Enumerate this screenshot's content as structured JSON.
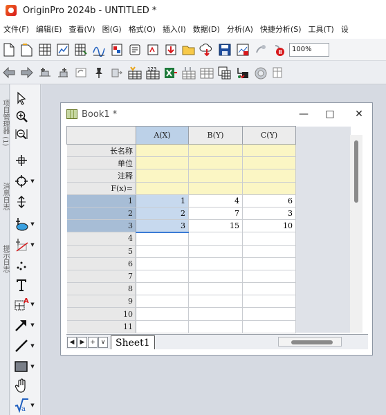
{
  "app": {
    "title": "OriginPro 2024b - UNTITLED *"
  },
  "menu": [
    "文件(F)",
    "编辑(E)",
    "查看(V)",
    "图(G)",
    "格式(O)",
    "插入(I)",
    "数据(D)",
    "分析(A)",
    "快捷分析(S)",
    "工具(T)",
    "设"
  ],
  "toolbar": {
    "zoom_value": "100%"
  },
  "side_panels": {
    "project_manager": "项目管理器 (1)",
    "message_log": "消息日志",
    "hint_log": "提示日志"
  },
  "book": {
    "title": "Book1 *",
    "minimize": "—",
    "maximize": "□",
    "close": "✕",
    "columns": [
      "A(X)",
      "B(Y)",
      "C(Y)"
    ],
    "meta_rows": [
      "长名称",
      "单位",
      "注释",
      "F(x)="
    ],
    "rows": [
      {
        "label": "1",
        "cells": [
          "1",
          "4",
          "6"
        ]
      },
      {
        "label": "2",
        "cells": [
          "2",
          "7",
          "3"
        ]
      },
      {
        "label": "3",
        "cells": [
          "3",
          "15",
          "10"
        ]
      },
      {
        "label": "4",
        "cells": [
          "",
          "",
          ""
        ]
      },
      {
        "label": "5",
        "cells": [
          "",
          "",
          ""
        ]
      },
      {
        "label": "6",
        "cells": [
          "",
          "",
          ""
        ]
      },
      {
        "label": "7",
        "cells": [
          "",
          "",
          ""
        ]
      },
      {
        "label": "8",
        "cells": [
          "",
          "",
          ""
        ]
      },
      {
        "label": "9",
        "cells": [
          "",
          "",
          ""
        ]
      },
      {
        "label": "10",
        "cells": [
          "",
          "",
          ""
        ]
      },
      {
        "label": "11",
        "cells": [
          "",
          "",
          ""
        ]
      }
    ],
    "sheet_tab": "Sheet1",
    "nav": {
      "prev": "◀",
      "next": "▶",
      "add": "+",
      "menu": "∨"
    }
  }
}
